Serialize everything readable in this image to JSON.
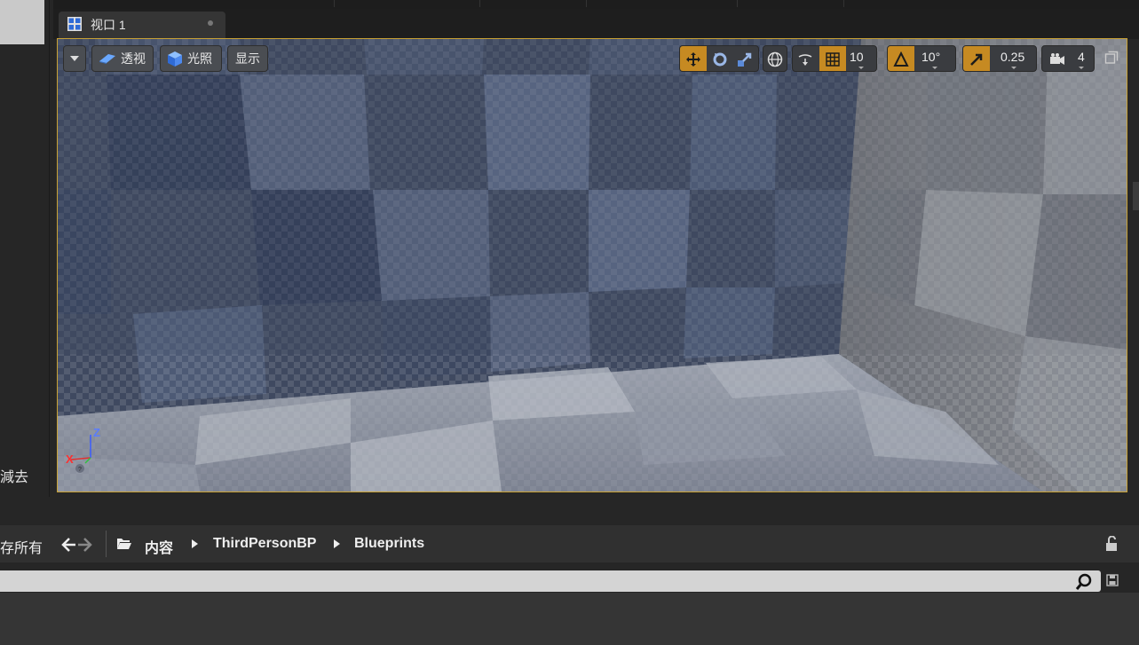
{
  "left_panel": {
    "partial_text": "減去"
  },
  "viewport_tab": {
    "title": "视口 1"
  },
  "viewport_toolbar": {
    "perspective_label": "透视",
    "lighting_label": "光照",
    "show_label": "显示",
    "grid_snap_value": "10",
    "rotation_snap_value": "10°",
    "scale_snap_value": "0.25",
    "camera_speed_value": "4"
  },
  "axis": {
    "z": "Z",
    "x": "X"
  },
  "content_browser": {
    "save_all_partial": "存所有",
    "breadcrumbs": [
      "内容",
      "ThirdPersonBP",
      "Blueprints"
    ]
  },
  "colors": {
    "accent": "#c68a22",
    "viewport_border": "#c9a235",
    "dark": "#262626"
  }
}
